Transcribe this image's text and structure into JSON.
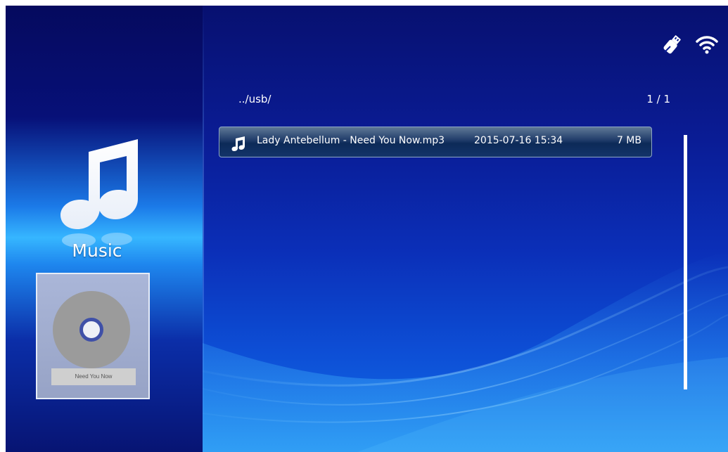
{
  "category": {
    "label": "Music",
    "icon": "music-note-icon"
  },
  "now_playing": {
    "album_title": "Need You Now"
  },
  "status": {
    "icons": [
      "usb-icon",
      "wifi-icon"
    ]
  },
  "browser": {
    "path": "../usb/",
    "page_indicator": "1 / 1",
    "files": [
      {
        "icon": "music-note-icon",
        "name": "Lady Antebellum - Need You Now.mp3",
        "date": "2015-07-16 15:34",
        "size": "7 MB",
        "selected": true
      }
    ]
  },
  "colors": {
    "background": "#0b2fb8",
    "selection": "#13346a",
    "text": "#ffffff"
  }
}
